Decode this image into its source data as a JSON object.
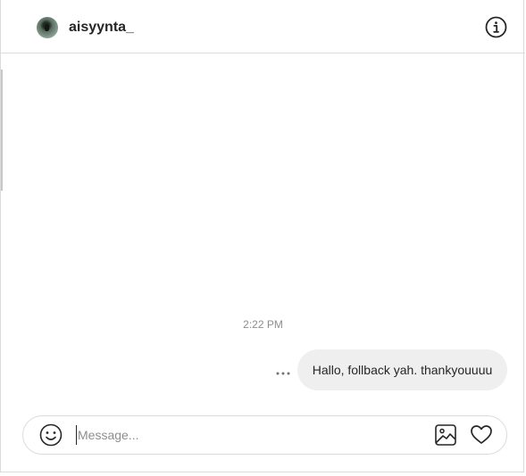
{
  "header": {
    "username": "aisyynta_",
    "avatar_icon": "profile-photo",
    "info_icon": "info-icon"
  },
  "thread": {
    "timestamp": "2:22 PM",
    "messages": [
      {
        "sender": "self",
        "text": "Hallo, follback yah. thankyouuuu"
      }
    ],
    "more_icon": "more-dots-icon"
  },
  "composer": {
    "placeholder": "Message...",
    "value": "",
    "icons": [
      "emoji-icon",
      "image-icon",
      "heart-icon"
    ]
  },
  "colors": {
    "text_primary": "#262626",
    "text_secondary": "#8e8e8e",
    "border": "#dbdbdb",
    "bubble_bg": "#efefef"
  }
}
